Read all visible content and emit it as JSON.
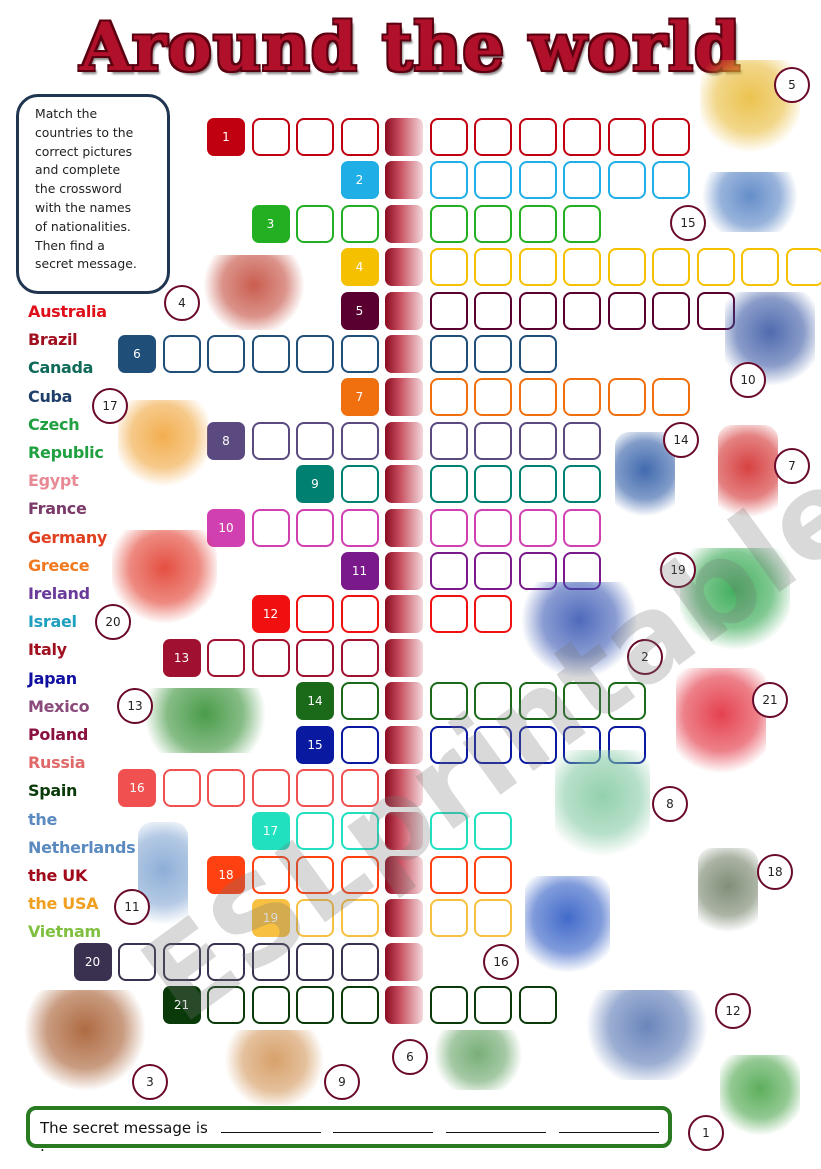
{
  "title": "Around the world",
  "instructions": [
    "Match the",
    "countries to the",
    "correct pictures",
    "and complete",
    "the crossword",
    "with the names",
    "of nationalities.",
    "Then find a",
    "secret message."
  ],
  "countries": [
    {
      "label": "Australia",
      "color": "#e0101a"
    },
    {
      "label": "Brazil",
      "color": "#a01020"
    },
    {
      "label": "Canada",
      "color": "#106a5a"
    },
    {
      "label": "Cuba",
      "color": "#1f3f6a"
    },
    {
      "label": "Czech",
      "color": "#20a040"
    },
    {
      "label": "Republic",
      "color": "#20a040"
    },
    {
      "label": "Egypt",
      "color": "#e88a96"
    },
    {
      "label": "France",
      "color": "#7a3a6a"
    },
    {
      "label": "Germany",
      "color": "#e04020"
    },
    {
      "label": "Greece",
      "color": "#f07a20"
    },
    {
      "label": "Ireland",
      "color": "#6a3a9a"
    },
    {
      "label": "Israel",
      "color": "#20a0c0"
    },
    {
      "label": "Italy",
      "color": "#a01020"
    },
    {
      "label": "Japan",
      "color": "#1010a0"
    },
    {
      "label": "Mexico",
      "color": "#8a4a7a"
    },
    {
      "label": "Poland",
      "color": "#8a1040"
    },
    {
      "label": "Russia",
      "color": "#e06a6a"
    },
    {
      "label": "Spain",
      "color": "#0a3a0a"
    },
    {
      "label": "the",
      "color": "#5a8ac0"
    },
    {
      "label": "Netherlands",
      "color": "#5a8ac0"
    },
    {
      "label": "the UK",
      "color": "#a00a1a"
    },
    {
      "label": "the USA",
      "color": "#f0a020"
    },
    {
      "label": "Vietnam",
      "color": "#80c040"
    }
  ],
  "crossword": {
    "secret_color": "#a0102a",
    "rows": [
      {
        "number": "1",
        "before": 3,
        "after": 6,
        "color": "#c00010"
      },
      {
        "number": "2",
        "before": 0,
        "after": 6,
        "color": "#20aee6"
      },
      {
        "number": "3",
        "before": 2,
        "after": 4,
        "color": "#22b022"
      },
      {
        "number": "4",
        "before": 0,
        "after": 9,
        "color": "#f5c000"
      },
      {
        "number": "5",
        "before": 0,
        "after": 7,
        "color": "#5a0030"
      },
      {
        "number": "6",
        "before": 5,
        "after": 3,
        "color": "#1f4e79"
      },
      {
        "number": "7",
        "before": 0,
        "after": 6,
        "color": "#f07010"
      },
      {
        "number": "8",
        "before": 3,
        "after": 4,
        "color": "#5a4a80"
      },
      {
        "number": "9",
        "before": 1,
        "after": 4,
        "color": "#008070"
      },
      {
        "number": "10",
        "before": 3,
        "after": 4,
        "color": "#d040b0"
      },
      {
        "number": "11",
        "before": 0,
        "after": 4,
        "color": "#7a1a8a"
      },
      {
        "number": "12",
        "before": 2,
        "after": 2,
        "color": "#f01010"
      },
      {
        "number": "13",
        "before": 4,
        "after": 0,
        "color": "#a01030"
      },
      {
        "number": "14",
        "before": 1,
        "after": 5,
        "color": "#1a6a1a"
      },
      {
        "number": "15",
        "before": 1,
        "after": 5,
        "color": "#0a1aa0"
      },
      {
        "number": "16",
        "before": 5,
        "after": 0,
        "color": "#f05050"
      },
      {
        "number": "17",
        "before": 2,
        "after": 2,
        "color": "#20e0c0"
      },
      {
        "number": "18",
        "before": 3,
        "after": 2,
        "color": "#ff4010"
      },
      {
        "number": "19",
        "before": 2,
        "after": 2,
        "color": "#f8c040"
      },
      {
        "number": "20",
        "before": 6,
        "after": 0,
        "color": "#3a3050"
      },
      {
        "number": "21",
        "before": 4,
        "after": 3,
        "color": "#0a3a0a"
      }
    ]
  },
  "pictures": [
    {
      "number": "5",
      "subject": "pyramids-camel",
      "color": "#e8b830"
    },
    {
      "number": "15",
      "subject": "italy-gondolier",
      "color": "#4a7ac0"
    },
    {
      "number": "4",
      "subject": "vietnam-boat",
      "color": "#c04030"
    },
    {
      "number": "10",
      "subject": "japanese-girl",
      "color": "#3050a0"
    },
    {
      "number": "17",
      "subject": "greek-lyre",
      "color": "#f0a030"
    },
    {
      "number": "14",
      "subject": "israeli-girl",
      "color": "#2050a0"
    },
    {
      "number": "7",
      "subject": "british-guard",
      "color": "#d02020"
    },
    {
      "number": "19",
      "subject": "irish-map",
      "color": "#20a040"
    },
    {
      "number": "20",
      "subject": "mariachi",
      "color": "#e03020"
    },
    {
      "number": "2",
      "subject": "russian-flag",
      "color": "#3050b0"
    },
    {
      "number": "13",
      "subject": "cuban-man",
      "color": "#2a8a2a"
    },
    {
      "number": "21",
      "subject": "canadian-hockey",
      "color": "#e02030"
    },
    {
      "number": "8",
      "subject": "statue-of-liberty",
      "color": "#80c8a0"
    },
    {
      "number": "18",
      "subject": "german-man",
      "color": "#6a7a60"
    },
    {
      "number": "11",
      "subject": "dutch-girl",
      "color": "#7aa0d0"
    },
    {
      "number": "16",
      "subject": "french-couple",
      "color": "#2050c0"
    },
    {
      "number": "12",
      "subject": "czech-castle",
      "color": "#5070b0"
    },
    {
      "number": "3",
      "subject": "spanish-bullfighter",
      "color": "#a05020"
    },
    {
      "number": "9",
      "subject": "polish-town",
      "color": "#d09050"
    },
    {
      "number": "6",
      "subject": "brazil-stadium",
      "color": "#60a060"
    },
    {
      "number": "1",
      "subject": "australian-man",
      "color": "#40a040"
    }
  ],
  "secret_message": {
    "label": "The secret message is",
    "end": "."
  },
  "watermark": "ESLprintables.com"
}
